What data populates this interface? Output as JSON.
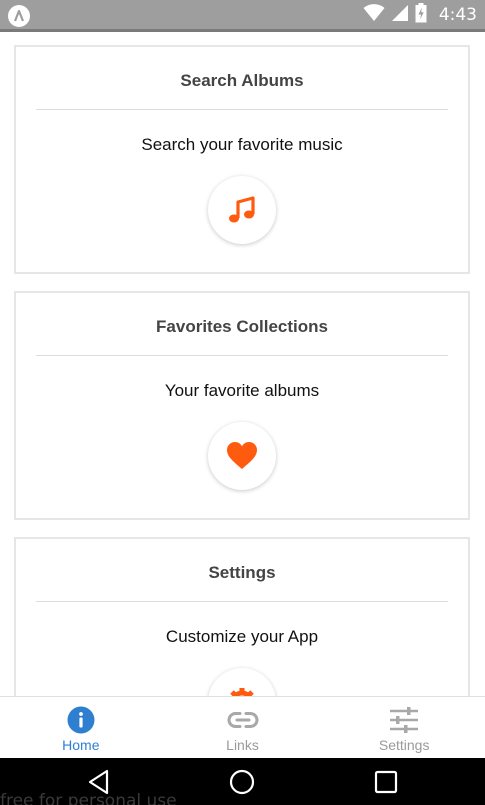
{
  "status_bar": {
    "time": "4:43",
    "icons": [
      "app-notification-icon",
      "wifi-icon",
      "signal-icon",
      "battery-icon"
    ]
  },
  "cards": [
    {
      "title": "Search Albums",
      "subtitle": "Search your favorite music",
      "icon": "music-note-icon"
    },
    {
      "title": "Favorites Collections",
      "subtitle": "Your favorite albums",
      "icon": "heart-icon"
    },
    {
      "title": "Settings",
      "subtitle": "Customize your App",
      "icon": "gear-icon"
    }
  ],
  "tabs": [
    {
      "label": "Home",
      "icon": "info-icon",
      "active": true
    },
    {
      "label": "Links",
      "icon": "link-icon",
      "active": false
    },
    {
      "label": "Settings",
      "icon": "sliders-icon",
      "active": false
    }
  ],
  "nav_bar": {
    "buttons": [
      "back-icon",
      "home-icon",
      "recents-icon"
    ],
    "watermark": "free for personal use"
  },
  "colors": {
    "accent": "#ff5b0e",
    "tab_active": "#2f7fd1",
    "tab_inactive": "#9a9a9a",
    "status_bar": "#9e9e9e"
  }
}
